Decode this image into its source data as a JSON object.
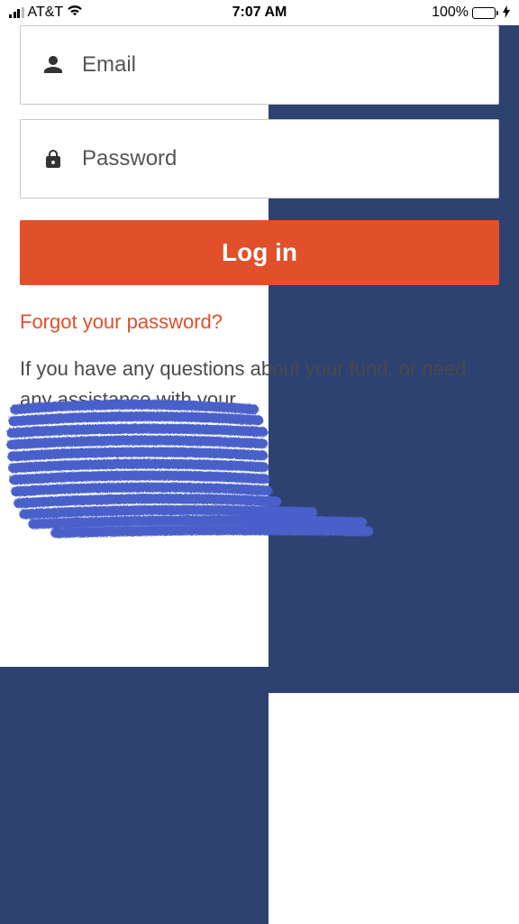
{
  "status_bar": {
    "carrier": "AT&T",
    "time": "7:07 AM",
    "battery_pct": "100%"
  },
  "login": {
    "email_placeholder": "Email",
    "password_placeholder": "Password",
    "login_label": "Log in",
    "forgot_label": "Forgot your password?",
    "help_text": "If you have any questions about your fund, or need any assistance with your"
  }
}
